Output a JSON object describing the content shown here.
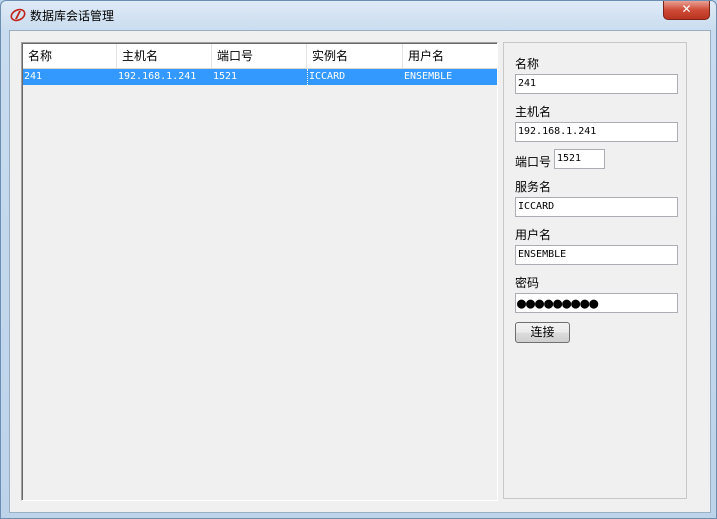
{
  "window": {
    "title": "数据库会话管理",
    "close_label": "✕"
  },
  "table": {
    "columns": [
      "名称",
      "主机名",
      "端口号",
      "实例名",
      "用户名"
    ],
    "rows": [
      [
        "241",
        "192.168.1.241",
        "1521",
        "ICCARD",
        "ENSEMBLE"
      ]
    ]
  },
  "form": {
    "name_label": "名称",
    "name_value": "241",
    "host_label": "主机名",
    "host_value": "192.168.1.241",
    "port_label": "端口号",
    "port_value": "1521",
    "service_label": "服务名",
    "service_value": "ICCARD",
    "user_label": "用户名",
    "user_value": "ENSEMBLE",
    "password_label": "密码",
    "password_mask": "●●●●●●●●●",
    "connect_label": "连接"
  },
  "colors": {
    "selection": "#3399ff",
    "close_button": "#cf4b37"
  }
}
